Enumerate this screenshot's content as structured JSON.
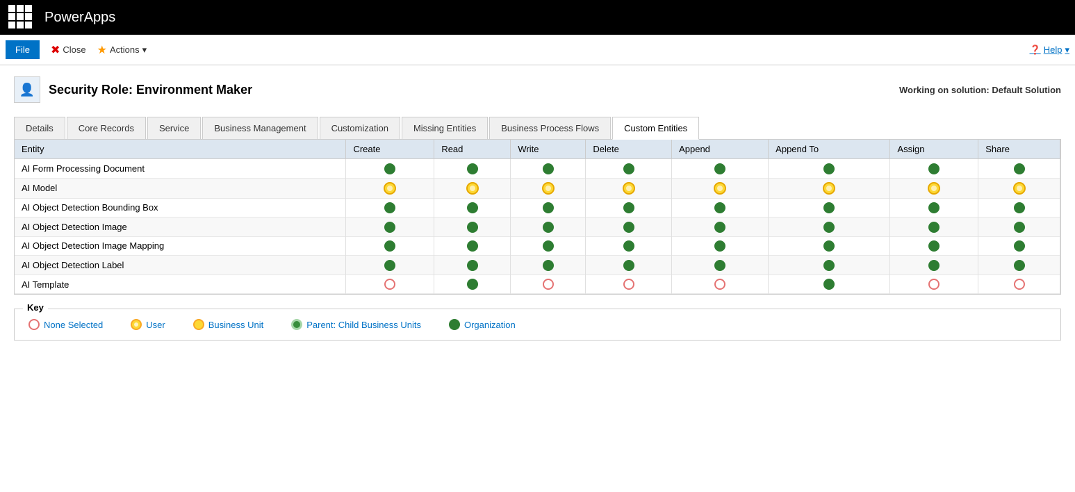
{
  "topbar": {
    "app_title": "PowerApps"
  },
  "toolbar": {
    "file_label": "File",
    "close_label": "Close",
    "actions_label": "Actions",
    "help_label": "Help"
  },
  "header": {
    "title": "Security Role: Environment Maker",
    "solution": "Working on solution: Default Solution"
  },
  "tabs": [
    {
      "id": "details",
      "label": "Details",
      "active": false
    },
    {
      "id": "core-records",
      "label": "Core Records",
      "active": false
    },
    {
      "id": "service",
      "label": "Service",
      "active": false
    },
    {
      "id": "business-management",
      "label": "Business Management",
      "active": false
    },
    {
      "id": "customization",
      "label": "Customization",
      "active": false
    },
    {
      "id": "missing-entities",
      "label": "Missing Entities",
      "active": false
    },
    {
      "id": "business-process-flows",
      "label": "Business Process Flows",
      "active": false
    },
    {
      "id": "custom-entities",
      "label": "Custom Entities",
      "active": true
    }
  ],
  "table": {
    "columns": [
      "Entity",
      "Create",
      "Read",
      "Write",
      "Delete",
      "Append",
      "Append To",
      "Assign",
      "Share"
    ],
    "rows": [
      {
        "entity": "AI Form Processing Document",
        "create": "green",
        "read": "green",
        "write": "green",
        "delete": "green",
        "append": "green",
        "appendTo": "green",
        "assign": "green",
        "share": "green"
      },
      {
        "entity": "AI Model",
        "create": "user",
        "read": "user",
        "write": "user",
        "delete": "user",
        "append": "user",
        "appendTo": "user",
        "assign": "user",
        "share": "user"
      },
      {
        "entity": "AI Object Detection Bounding Box",
        "create": "green",
        "read": "green",
        "write": "green",
        "delete": "green",
        "append": "green",
        "appendTo": "green",
        "assign": "green",
        "share": "green"
      },
      {
        "entity": "AI Object Detection Image",
        "create": "green",
        "read": "green",
        "write": "green",
        "delete": "green",
        "append": "green",
        "appendTo": "green",
        "assign": "green",
        "share": "green"
      },
      {
        "entity": "AI Object Detection Image Mapping",
        "create": "green",
        "read": "green",
        "write": "green",
        "delete": "green",
        "append": "green",
        "appendTo": "green",
        "assign": "green",
        "share": "green"
      },
      {
        "entity": "AI Object Detection Label",
        "create": "green",
        "read": "green",
        "write": "green",
        "delete": "green",
        "append": "green",
        "appendTo": "green",
        "assign": "green",
        "share": "green"
      },
      {
        "entity": "AI Template",
        "create": "none",
        "read": "green",
        "write": "none",
        "delete": "none",
        "append": "none",
        "appendTo": "green",
        "assign": "none",
        "share": "none"
      }
    ]
  },
  "key": {
    "title": "Key",
    "items": [
      {
        "id": "none",
        "type": "none",
        "label": "None Selected"
      },
      {
        "id": "user",
        "type": "user",
        "label": "User"
      },
      {
        "id": "business-unit",
        "type": "business-unit",
        "label": "Business Unit"
      },
      {
        "id": "parent-child",
        "type": "parent-child",
        "label": "Parent: Child Business Units"
      },
      {
        "id": "organization",
        "type": "organization",
        "label": "Organization"
      }
    ]
  }
}
